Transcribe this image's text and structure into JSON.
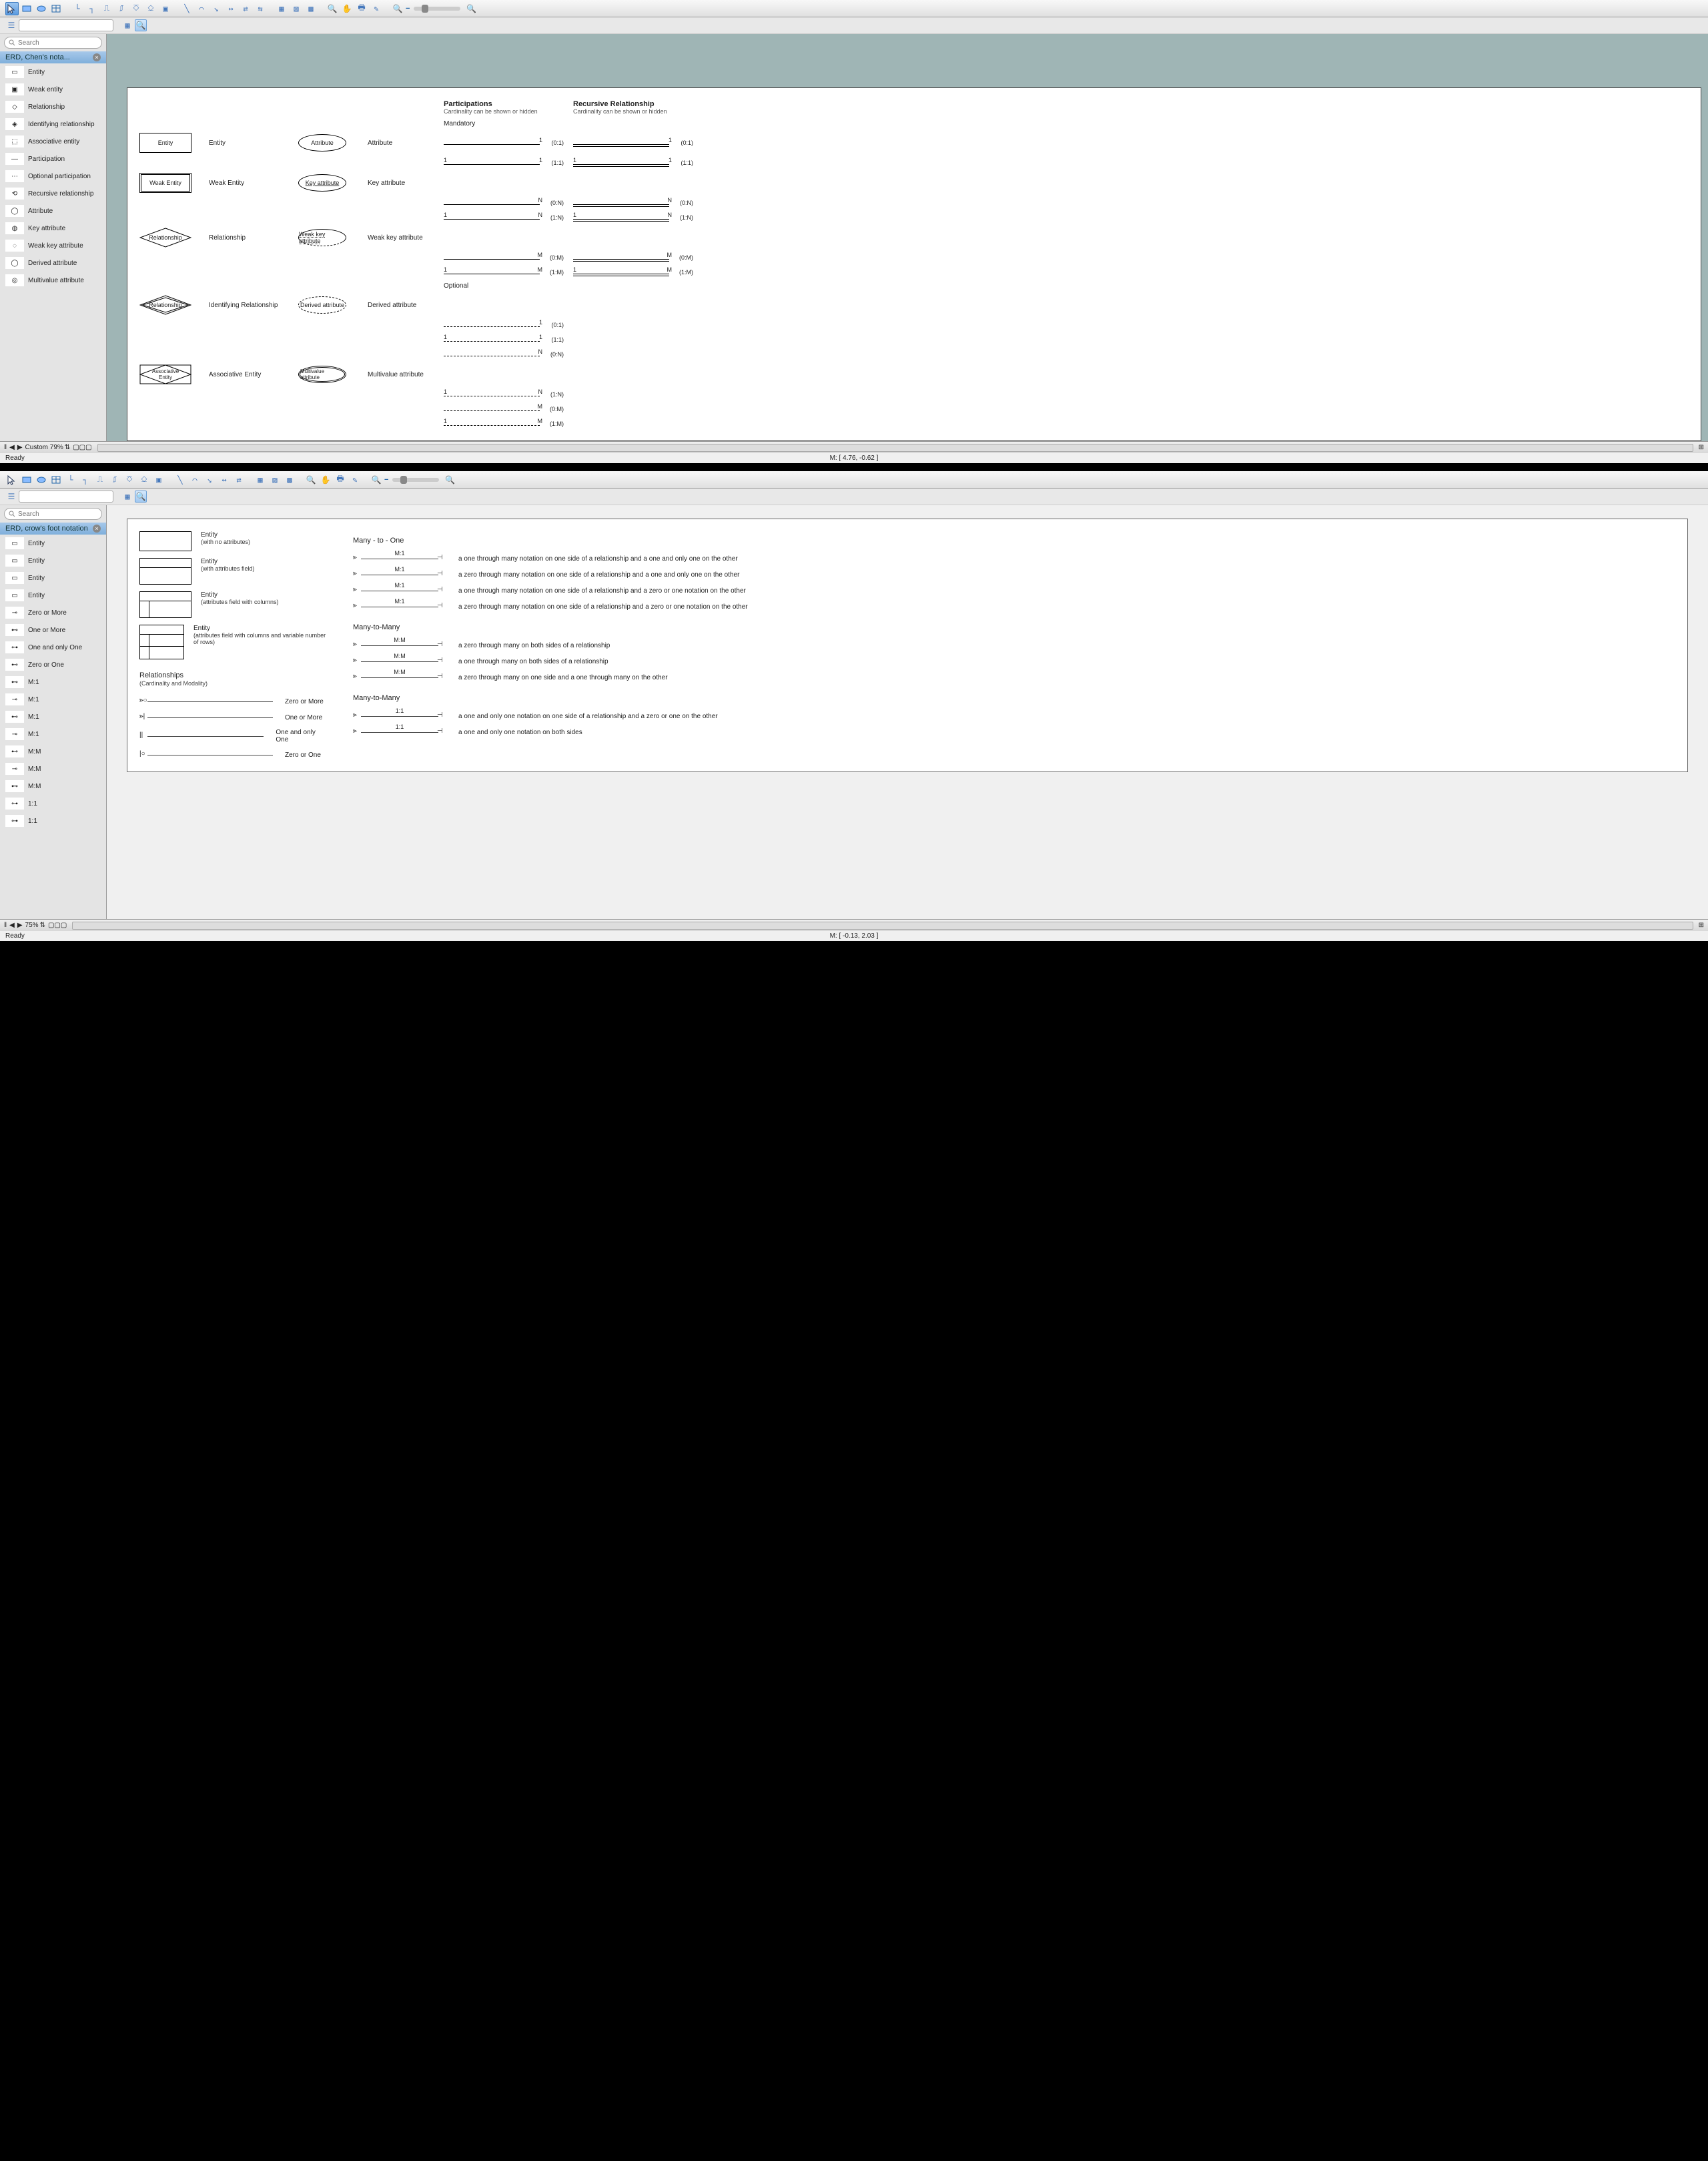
{
  "app1": {
    "search_placeholder": "Search",
    "sidebar": {
      "header": "ERD, Chen's nota...",
      "items": [
        "Entity",
        "Weak entity",
        "Relationship",
        "Identifying relationship",
        "Associative entity",
        "Participation",
        "Optional participation",
        "Recursive relationship",
        "Attribute",
        "Key attribute",
        "Weak key attribute",
        "Derived attribute",
        "Multivalue attribute"
      ]
    },
    "zoom_label": "Custom 79%",
    "status_left": "Ready",
    "status_mid": "M: [ 4.76, -0.62 ]",
    "chen": {
      "col_part_hdr": "Participations",
      "col_part_sub": "Cardinality can be shown or hidden",
      "col_rec_hdr": "Recursive Relationship",
      "col_rec_sub": "Cardinality can be shown or hidden",
      "mandatory": "Mandatory",
      "optional": "Optional",
      "shapes": [
        {
          "s": "Entity",
          "l": "Entity",
          "a": "Attribute",
          "al": "Attribute"
        },
        {
          "s": "Weak Entity",
          "l": "Weak Entity",
          "a": "Key attribute",
          "al": "Key attribute"
        },
        {
          "s": "Relationship",
          "l": "Relationship",
          "a": "Weak key attribute",
          "al": "Weak key attribute"
        },
        {
          "s": "Relationship",
          "l": "Identifying Relationship",
          "a": "Derived attribute",
          "al": "Derived attribute"
        },
        {
          "s": "Associative Entity",
          "l": "Associative Entity",
          "a": "Multivalue attribute",
          "al": "Multivalue attribute"
        }
      ],
      "mandatory_rows": [
        {
          "l": "",
          "r": "1",
          "p": "(0:1)"
        },
        {
          "l": "1",
          "r": "1",
          "p": "(1:1)"
        },
        {
          "l": "",
          "r": "N",
          "p": "(0:N)"
        },
        {
          "l": "1",
          "r": "N",
          "p": "(1:N)"
        },
        {
          "l": "",
          "r": "M",
          "p": "(0:M)"
        },
        {
          "l": "1",
          "r": "M",
          "p": "(1:M)"
        }
      ],
      "optional_rows": [
        {
          "l": "",
          "r": "1",
          "p": "(0:1)"
        },
        {
          "l": "1",
          "r": "1",
          "p": "(1:1)"
        },
        {
          "l": "",
          "r": "N",
          "p": "(0:N)"
        },
        {
          "l": "1",
          "r": "N",
          "p": "(1:N)"
        },
        {
          "l": "",
          "r": "M",
          "p": "(0:M)"
        },
        {
          "l": "1",
          "r": "M",
          "p": "(1:M)"
        }
      ]
    }
  },
  "app2": {
    "search_placeholder": "Search",
    "sidebar": {
      "header": "ERD, crow's foot notation",
      "items": [
        "Entity",
        "Entity",
        "Entity",
        "Entity",
        "Zero or More",
        "One or More",
        "One and only One",
        "Zero or One",
        "M:1",
        "M:1",
        "M:1",
        "M:1",
        "M:M",
        "M:M",
        "M:M",
        "1:1",
        "1:1"
      ]
    },
    "zoom_label": "75%",
    "status_left": "Ready",
    "status_mid": "M: [ -0.13, 2.03 ]",
    "cf": {
      "ent": [
        {
          "t": "Entity",
          "s": "(with no attributes)"
        },
        {
          "t": "Entity",
          "s": "(with attributes field)"
        },
        {
          "t": "Entity",
          "s": "(attributes field with columns)"
        },
        {
          "t": "Entity",
          "s": "(attributes field with columns and variable number of rows)"
        }
      ],
      "rel_hdr": "Relationships",
      "rel_sub": "(Cardinality and Modality)",
      "simple": [
        {
          "l": "Zero or More"
        },
        {
          "l": "One or More"
        },
        {
          "l": "One and only One"
        },
        {
          "l": "Zero or One"
        }
      ],
      "sections": [
        {
          "hdr": "Many - to - One",
          "rows": [
            {
              "c": "M:1",
              "d": "a one through many notation on one side of a relationship and a one and only one on the other"
            },
            {
              "c": "M:1",
              "d": "a zero through many notation on one side of a relationship and a one and only one on the other"
            },
            {
              "c": "M:1",
              "d": "a one through many notation on one side of a relationship and a zero or one notation on the other"
            },
            {
              "c": "M:1",
              "d": "a zero through many notation on one side of a relationship and a zero or one notation on the other"
            }
          ]
        },
        {
          "hdr": "Many-to-Many",
          "rows": [
            {
              "c": "M:M",
              "d": "a zero through many on both sides of a relationship"
            },
            {
              "c": "M:M",
              "d": "a one through many on both sides of a relationship"
            },
            {
              "c": "M:M",
              "d": "a zero through many on one side and a one through many on the other"
            }
          ]
        },
        {
          "hdr": "Many-to-Many",
          "rows": [
            {
              "c": "1:1",
              "d": "a one and only one notation on one side of a relationship and a zero or one on the other"
            },
            {
              "c": "1:1",
              "d": "a one and only one notation on both sides"
            }
          ]
        }
      ]
    }
  }
}
